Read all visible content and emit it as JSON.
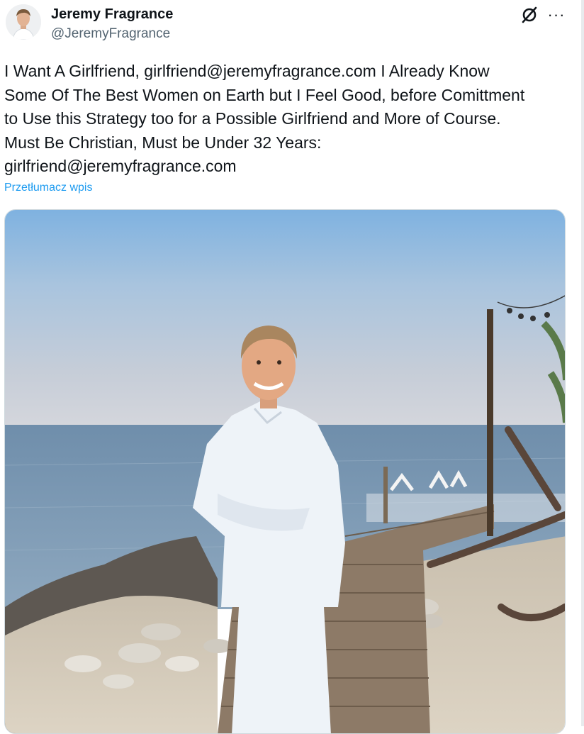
{
  "author": {
    "name": "Jeremy Fragrance",
    "handle": "@JeremyFragrance",
    "avatar_icon": "profile-photo"
  },
  "header_actions": {
    "grok_icon": "grok-slash-circle-icon",
    "more_icon": "more-horizontal-icon",
    "more_label": "···"
  },
  "post": {
    "text": "I Want A Girlfriend, girlfriend@jeremyfragrance.com I Already Know\nSome Of The Best Women on Earth but I Feel Good, before Comittment\nto Use this Strategy too for a Possible Girlfriend and More of Course.\nMust Be Christian, Must be Under 32 Years:\ngirlfriend@jeremyfragrance.com",
    "translate_label": "Przetłumacz wpis"
  },
  "media": {
    "kind": "photo",
    "scene": "man in white suit on wooden boardwalk by the sea"
  },
  "colors": {
    "link": "#1d9bf0",
    "secondary_text": "#536471",
    "primary_text": "#0f1419"
  }
}
